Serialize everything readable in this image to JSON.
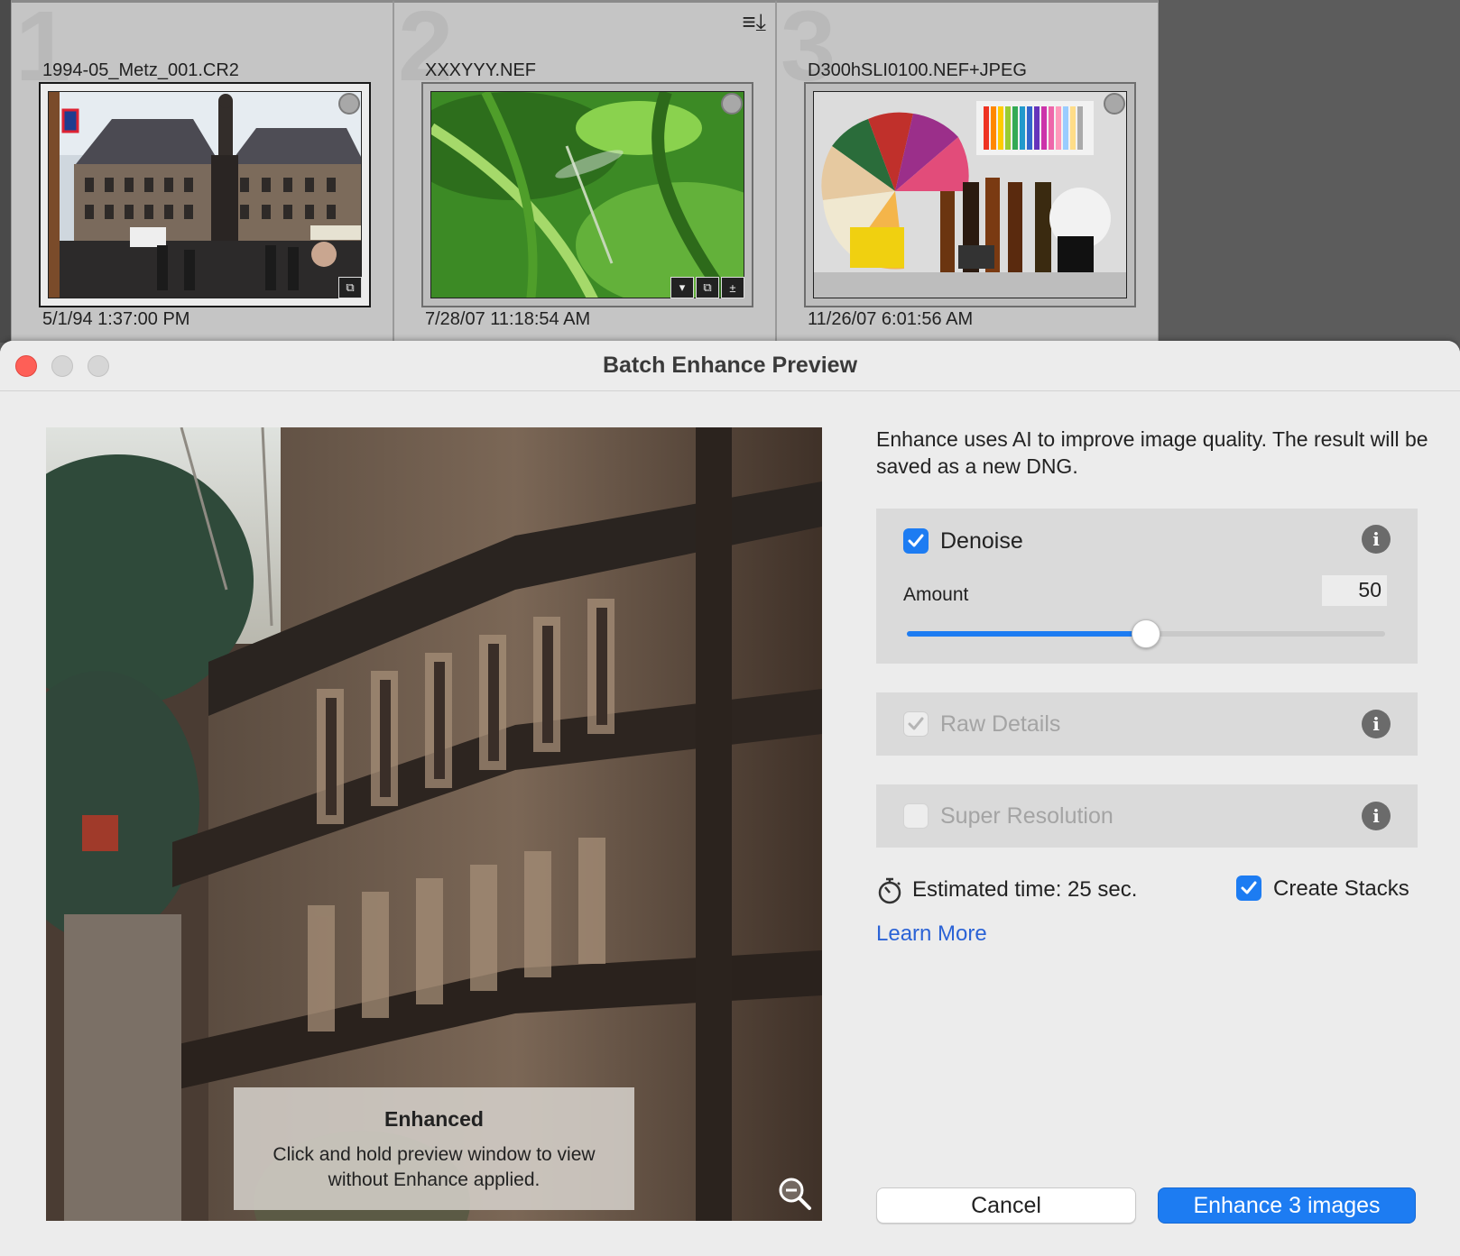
{
  "grid": {
    "cells": [
      {
        "index": "1",
        "filename": "1994-05_Metz_001.CR2",
        "date": "5/1/94 1:37:00 PM",
        "selected": true
      },
      {
        "index": "2",
        "filename": "XXXYYY.NEF",
        "date": "7/28/07 11:18:54 AM",
        "selected": false
      },
      {
        "index": "3",
        "filename": "D300hSLI0100.NEF+JPEG",
        "date": "11/26/07 6:01:56 AM",
        "selected": false
      }
    ]
  },
  "dialog": {
    "title": "Batch Enhance Preview",
    "description": "Enhance uses AI to improve image quality. The result will be saved as a new DNG.",
    "preview": {
      "overlay_title": "Enhanced",
      "overlay_text": "Click and hold preview window to view without Enhance applied."
    },
    "denoise": {
      "label": "Denoise",
      "checked": true,
      "amount_label": "Amount",
      "amount": "50",
      "amount_fraction": 0.5
    },
    "raw_details": {
      "label": "Raw Details",
      "checked": true,
      "enabled": false
    },
    "super_resolution": {
      "label": "Super Resolution",
      "checked": false,
      "enabled": false
    },
    "estimated_time": "Estimated time: 25 sec.",
    "create_stacks": {
      "label": "Create Stacks",
      "checked": true
    },
    "learn_more": "Learn More",
    "buttons": {
      "cancel": "Cancel",
      "primary": "Enhance 3 images"
    }
  },
  "colors": {
    "accent": "#1d7cf2",
    "link": "#2b63d6",
    "close": "#fe5f57"
  }
}
